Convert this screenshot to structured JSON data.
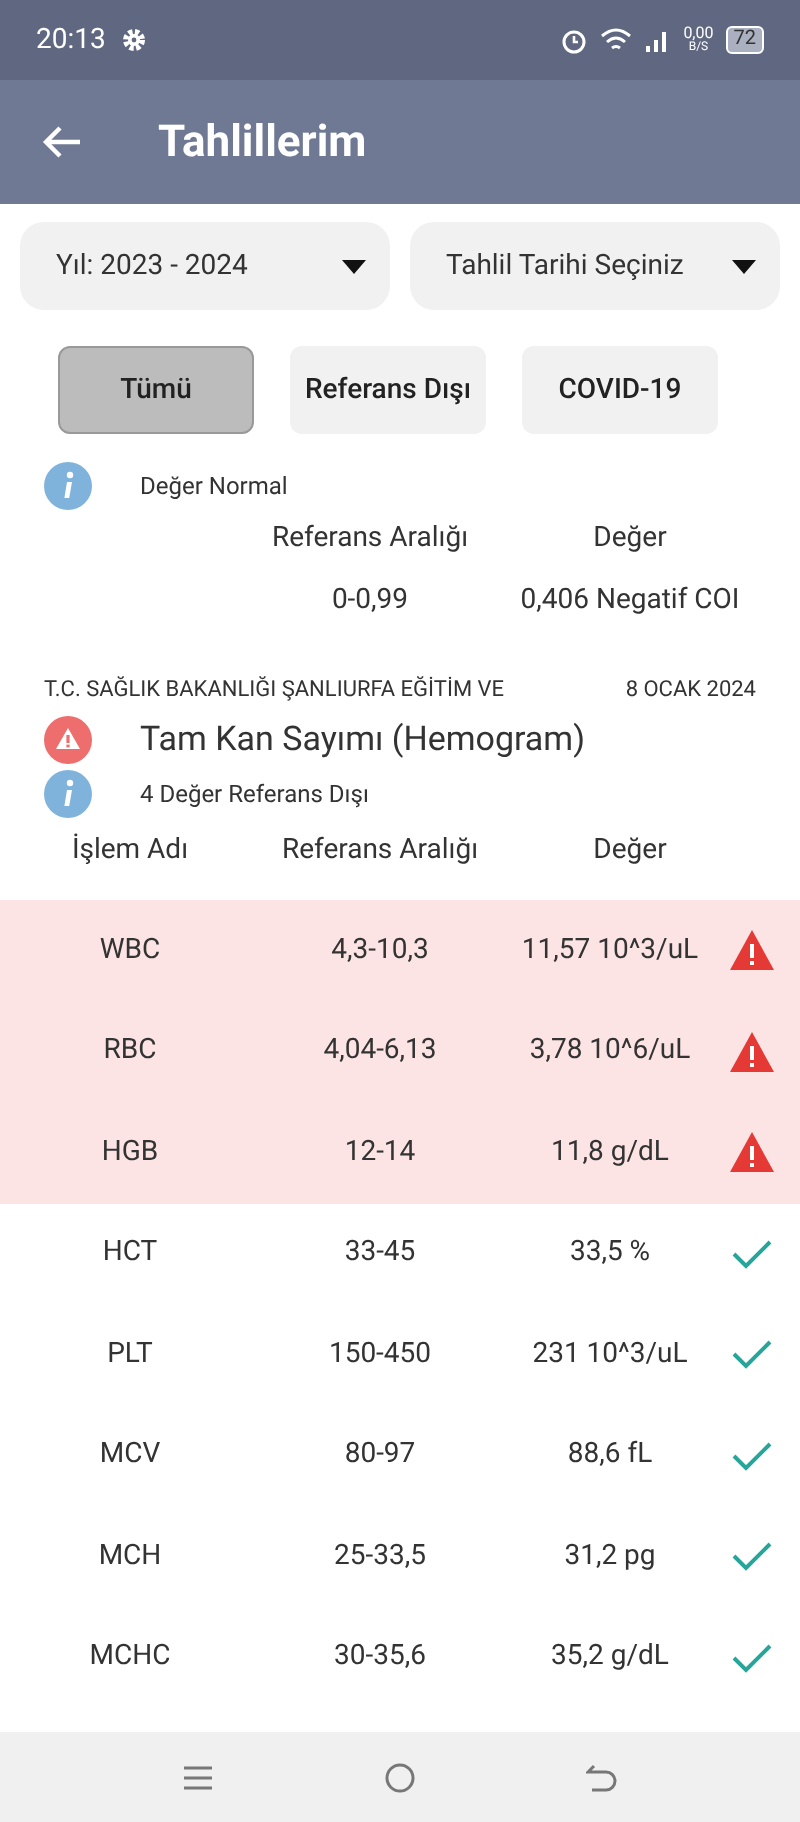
{
  "status_bar": {
    "time": "20:13",
    "speed": "0,00",
    "speed_unit": "B/S",
    "battery": "72"
  },
  "app_bar": {
    "title": "Tahlillerim"
  },
  "filters": [
    {
      "label": "Yıl: 2023 - 2024"
    },
    {
      "label": "Tahlil Tarihi Seçiniz"
    }
  ],
  "categories": [
    {
      "label": "Tümü",
      "selected": true
    },
    {
      "label": "Referans Dışı",
      "selected": false
    },
    {
      "label": "COVID-19",
      "selected": false
    }
  ],
  "first_result": {
    "note": "Değer Normal",
    "columns": [
      "Referans Aralığı",
      "Değer"
    ],
    "range": "0-0,99",
    "value": "0,406 Negatif COI"
  },
  "second_result": {
    "source": "T.C. SAĞLIK BAKANLIĞI ŞANLIURFA EĞİTİM VE",
    "date": "8 OCAK 2024",
    "title": "Tam Kan Sayımı (Hemogram)",
    "flagged": true,
    "note": "4 Değer Referans Dışı",
    "columns": [
      "İşlem Adı",
      "Referans Aralığı",
      "Değer"
    ],
    "rows": [
      {
        "name": "WBC",
        "range": "4,3-10,3",
        "value": "11,57 10^3/uL",
        "flagged": true
      },
      {
        "name": "RBC",
        "range": "4,04-6,13",
        "value": "3,78 10^6/uL",
        "flagged": true
      },
      {
        "name": "HGB",
        "range": "12-14",
        "value": "11,8 g/dL",
        "flagged": true
      },
      {
        "name": "HCT",
        "range": "33-45",
        "value": "33,5 %",
        "flagged": false
      },
      {
        "name": "PLT",
        "range": "150-450",
        "value": "231 10^3/uL",
        "flagged": false
      },
      {
        "name": "MCV",
        "range": "80-97",
        "value": "88,6 fL",
        "flagged": false
      },
      {
        "name": "MCH",
        "range": "25-33,5",
        "value": "31,2 pg",
        "flagged": false
      },
      {
        "name": "MCHC",
        "range": "30-35,6",
        "value": "35,2 g/dL",
        "flagged": false
      }
    ]
  }
}
